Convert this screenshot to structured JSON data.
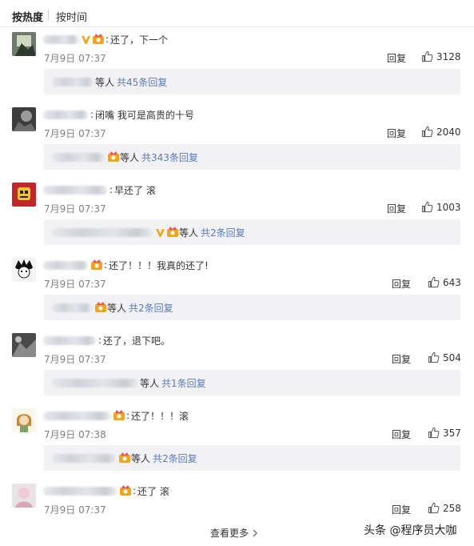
{
  "sort": {
    "hot_label": "按热度",
    "time_label": "按时间"
  },
  "comments": [
    {
      "text": "还了，下一个",
      "time": "7月9日 07:37",
      "reply_label": "回复",
      "likes": "3128",
      "sub": {
        "suffix": "等人",
        "link": "共45条回复"
      }
    },
    {
      "text": "闭嘴 我可是高贵的十号",
      "time": "7月9日 07:37",
      "reply_label": "回复",
      "likes": "2040",
      "sub": {
        "suffix": "等人",
        "link": "共343条回复"
      }
    },
    {
      "text": "早还了 滚",
      "time": "7月9日 07:37",
      "reply_label": "回复",
      "likes": "1003",
      "sub": {
        "suffix": "等人",
        "link": "共2条回复"
      }
    },
    {
      "text": "还了！！！我真的还了!",
      "time": "7月9日 07:37",
      "reply_label": "回复",
      "likes": "643",
      "sub": {
        "suffix": "等人",
        "link": "共2条回复"
      }
    },
    {
      "text": "还了，退下吧。",
      "time": "7月9日 07:37",
      "reply_label": "回复",
      "likes": "504",
      "sub": {
        "suffix": "等人",
        "link": "共1条回复"
      }
    },
    {
      "text": "还了！！！滚",
      "time": "7月9日 07:38",
      "reply_label": "回复",
      "likes": "357",
      "sub": {
        "suffix": "等人",
        "link": "共2条回复"
      }
    },
    {
      "text": "还了 滚",
      "time": "7月9日 07:37",
      "reply_label": "回复",
      "likes": "258"
    }
  ],
  "footer": {
    "more_label": "查看更多",
    "watermark": "头条 @程序员大咖"
  },
  "colors": {
    "link": "#5b7bbf",
    "muted": "#808080",
    "subbox_bg": "#f2f2f5",
    "badge_gold": "#f0a51a"
  }
}
